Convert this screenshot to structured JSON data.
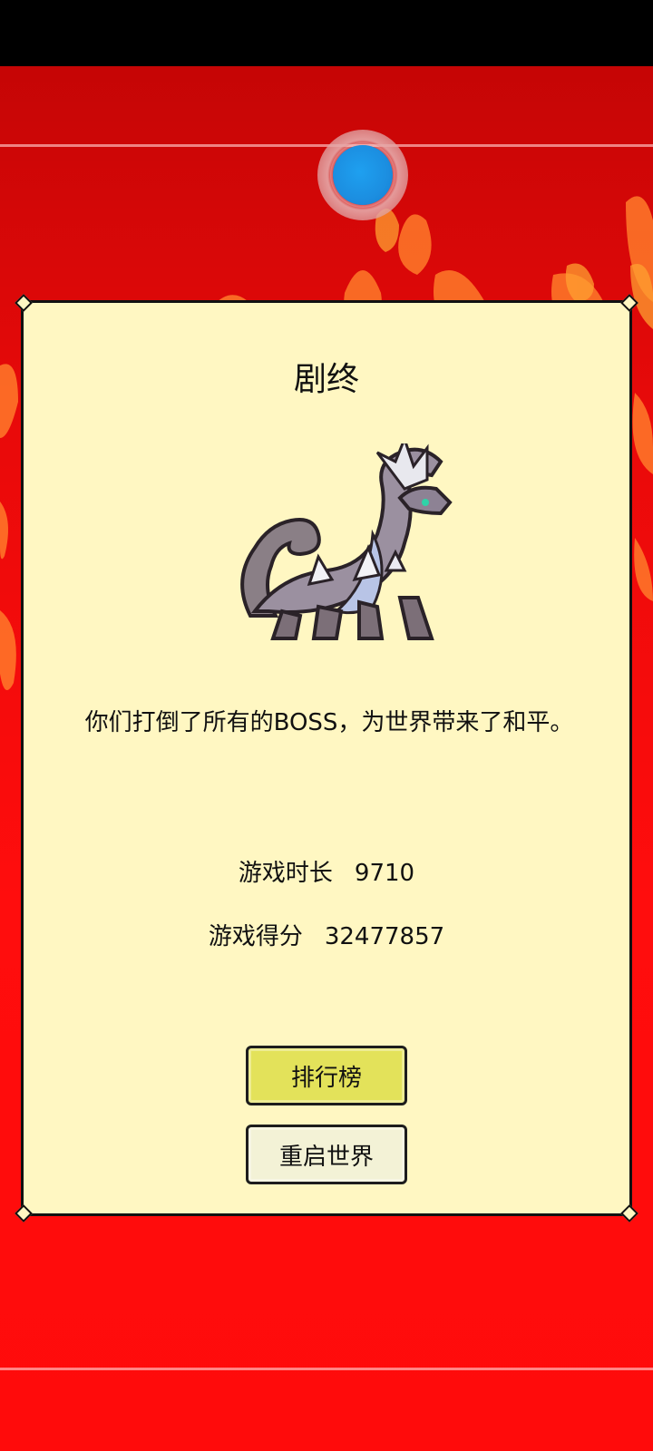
{
  "dialog": {
    "title": "剧终",
    "message": "你们打倒了所有的BOSS，为世界带来了和平。",
    "stats": {
      "time_label": "游戏时长",
      "time_value": "9710",
      "score_label": "游戏得分",
      "score_value": "32477857"
    },
    "buttons": {
      "leaderboard": "排行榜",
      "restart": "重启世界"
    }
  },
  "colors": {
    "panel": "#fff7c2",
    "leaderboard_button": "#e3e25a",
    "restart_button": "#f3f2d6",
    "orb": "#1c8ee0"
  },
  "icons": {
    "boss": "white-dragon-icon",
    "orb": "blue-orb-icon"
  }
}
